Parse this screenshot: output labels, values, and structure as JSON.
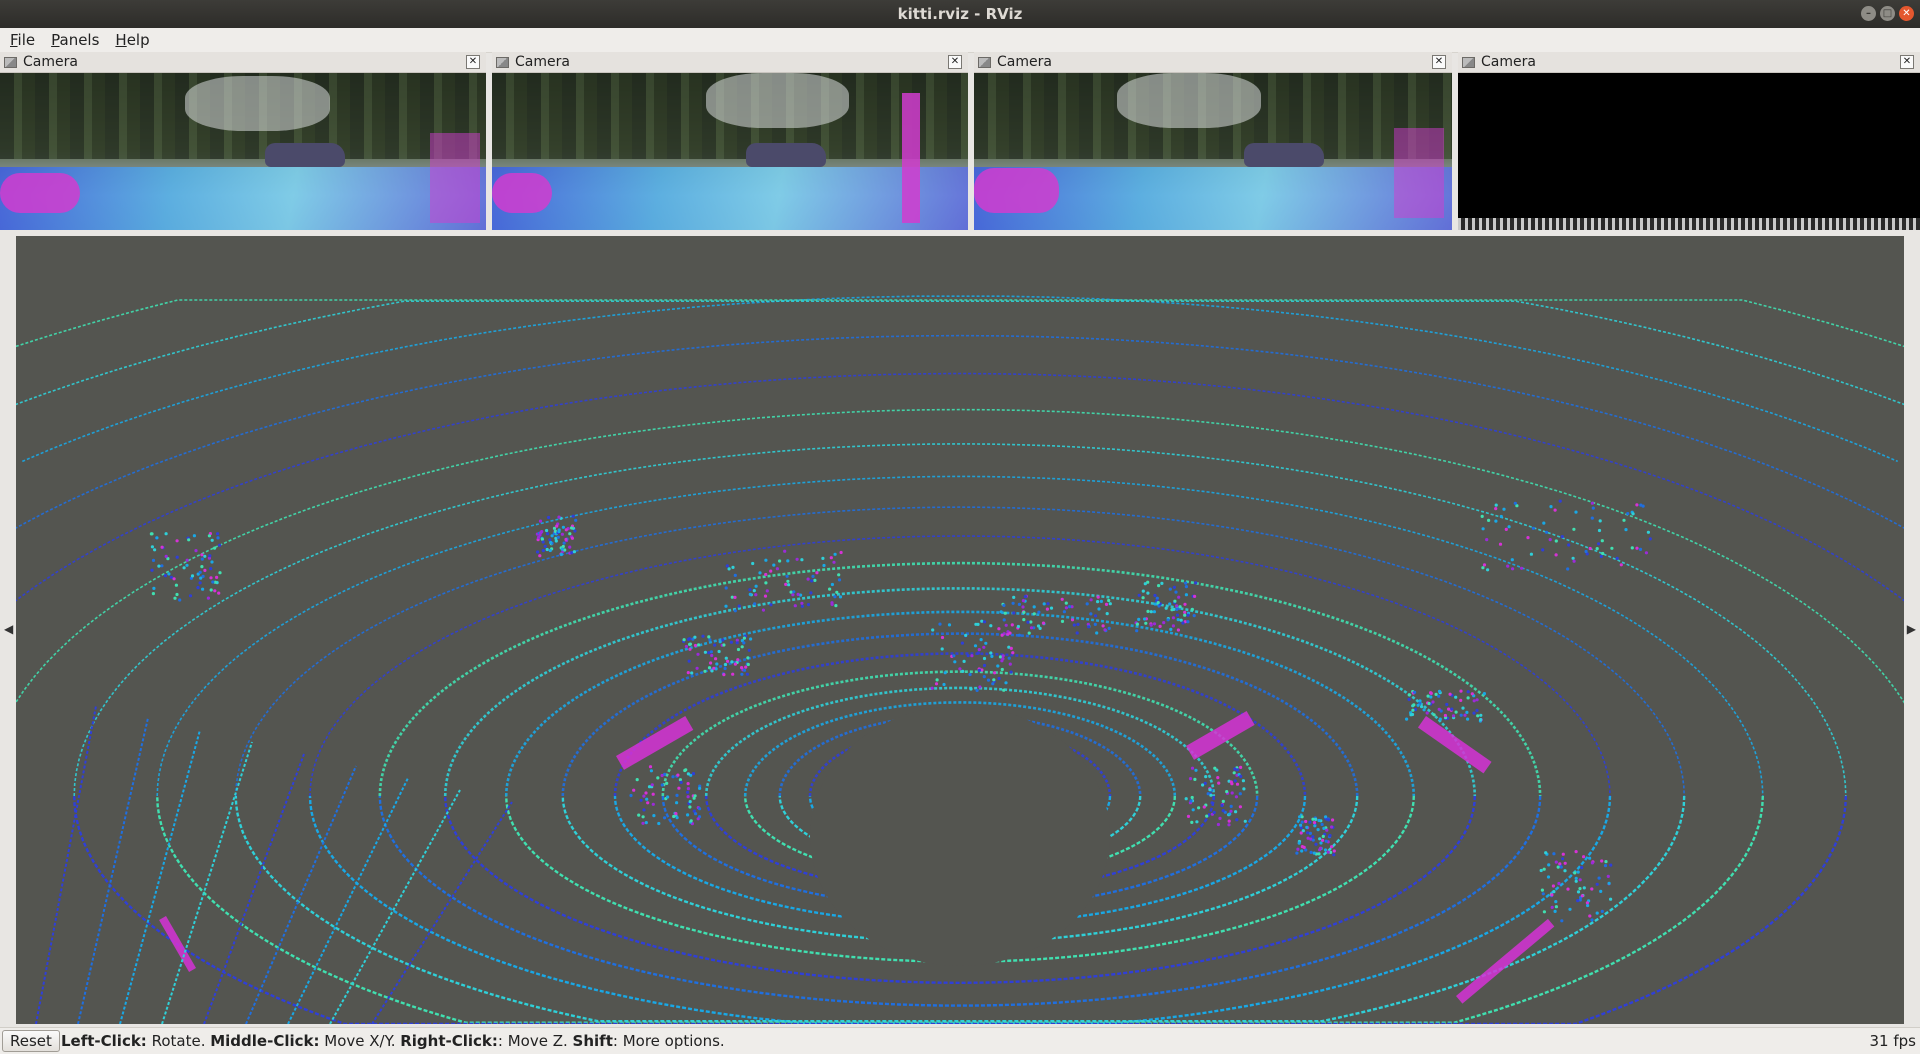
{
  "window": {
    "title": "kitti.rviz - RViz"
  },
  "menu": [
    {
      "accel": "F",
      "rest": "ile"
    },
    {
      "accel": "P",
      "rest": "anels"
    },
    {
      "accel": "H",
      "rest": "elp"
    }
  ],
  "panels": [
    {
      "title": "Camera"
    },
    {
      "title": "Camera"
    },
    {
      "title": "Camera"
    },
    {
      "title": "Camera"
    }
  ],
  "status": {
    "reset_label": "Reset",
    "hints": [
      {
        "key": "Left-Click:",
        "text": " Rotate. "
      },
      {
        "key": "Middle-Click:",
        "text": " Move X/Y. "
      },
      {
        "key": "Right-Click:",
        "text": ": Move Z. "
      },
      {
        "key": "Shift",
        "text": ": More options."
      }
    ],
    "fps": "31 fps"
  },
  "colors": {
    "viewport_bg": "#545550",
    "cloud_colors": [
      "#2f3fd8",
      "#1f6fe0",
      "#19a8e6",
      "#2fd0d8",
      "#40e0b0",
      "#d632d6",
      "#9b2bd9"
    ]
  }
}
